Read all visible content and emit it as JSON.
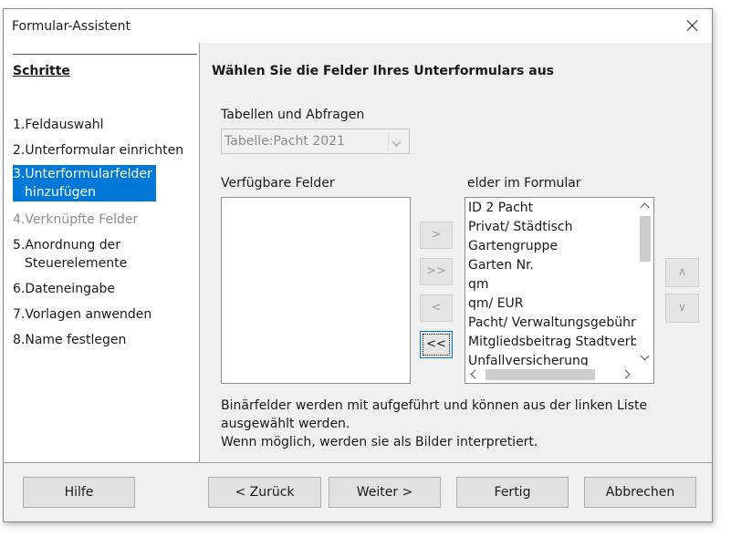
{
  "window": {
    "title": "Formular-Assistent"
  },
  "sidebar": {
    "title": "Schritte",
    "steps": [
      {
        "num": "1.",
        "label": "Feldauswahl"
      },
      {
        "num": "2.",
        "label": "Unterformular einrichten"
      },
      {
        "num": "3.",
        "label_line1": "Unterformularfelder",
        "label_line2": "hinzufügen"
      },
      {
        "num": "4.",
        "label": "Verknüpfte Felder"
      },
      {
        "num": "5.",
        "label_line1": "Anordnung der",
        "label_line2": "Steuerelemente"
      },
      {
        "num": "6.",
        "label": "Dateneingabe"
      },
      {
        "num": "7.",
        "label": "Vorlagen anwenden"
      },
      {
        "num": "8.",
        "label": "Name festlegen"
      }
    ]
  },
  "main": {
    "heading": "Wählen Sie die Felder Ihres Unterformulars aus",
    "tables_label": "Tabellen und Abfragen",
    "tables_value": "Tabelle:Pacht 2021",
    "available_label": "Verfügbare Felder",
    "selected_label": "elder im Formular",
    "selected_fields": [
      "ID 2 Pacht",
      "Privat/ Städtisch",
      "Gartengruppe",
      "Garten Nr.",
      "qm",
      "qm/ EUR",
      "Pacht/ Verwaltungsgebühr",
      "Mitgliedsbeitrag Stadtverband",
      "Unfallversicherung"
    ],
    "transfer_buttons": {
      "add": ">",
      "add_all": ">>",
      "remove": "<",
      "remove_all": "<<"
    },
    "order_buttons": {
      "up": "∧",
      "down": "∨"
    },
    "info_line1": "Binärfelder werden mit aufgeführt und können aus der linken Liste ausgewählt werden.",
    "info_line2": "Wenn möglich, werden sie als Bilder interpretiert."
  },
  "footer": {
    "help": "Hilfe",
    "back": "< Zurück",
    "next": "Weiter >",
    "finish": "Fertig",
    "cancel": "Abbrechen"
  }
}
